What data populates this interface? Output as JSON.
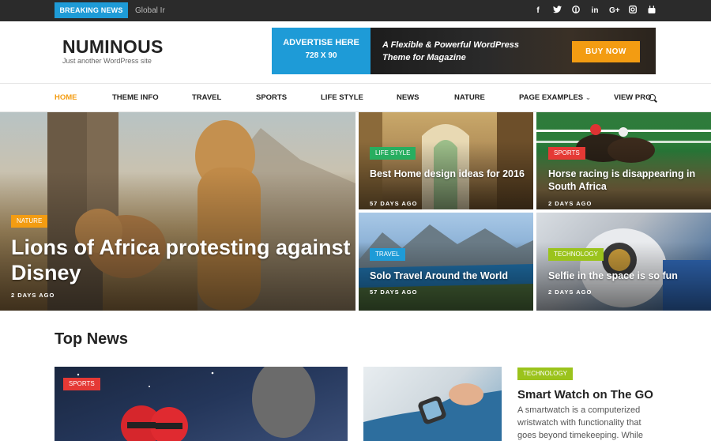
{
  "topbar": {
    "breaking_label": "BREAKING NEWS",
    "ticker": "Global Ir",
    "social": [
      "f",
      "t",
      "p",
      "in",
      "G+",
      "ig",
      "yt"
    ]
  },
  "header": {
    "logo": "NUMINOUS",
    "tagline": "Just another WordPress site",
    "ad": {
      "line1": "ADVERTISE HERE",
      "line2": "728 X 90",
      "promo1": "A Flexible & Powerful WordPress",
      "promo2": "Theme for Magazine",
      "buy": "BUY NOW"
    }
  },
  "nav": {
    "items": [
      "HOME",
      "THEME INFO",
      "TRAVEL",
      "SPORTS",
      "LIFE STYLE",
      "NEWS",
      "NATURE",
      "PAGE EXAMPLES",
      "VIEW PRO"
    ]
  },
  "featured": [
    {
      "category": "NATURE",
      "title": "Lions of Africa protesting against Disney",
      "date": "2 DAYS AGO",
      "color": "#f39c12"
    },
    {
      "category": "LIFE STYLE",
      "title": "Best Home design ideas for 2016",
      "date": "57 DAYS AGO",
      "color": "#27ae60"
    },
    {
      "category": "SPORTS",
      "title": "Horse racing is disappearing in South Africa",
      "date": "2 DAYS AGO",
      "color": "#e53935"
    },
    {
      "category": "TRAVEL",
      "title": "Solo Travel Around the World",
      "date": "57 DAYS AGO",
      "color": "#1e9bd7"
    },
    {
      "category": "TECHNOLOGY",
      "title": "Selfie in the space is so fun",
      "date": "2 DAYS AGO",
      "color": "#9bc31c"
    }
  ],
  "top_news": {
    "heading": "Top News",
    "card1_category": "SPORTS",
    "card2": {
      "category": "TECHNOLOGY",
      "title": "Smart Watch on The GO",
      "desc": "A smartwatch is a computerized wristwatch with functionality that goes beyond timekeeping. While"
    }
  }
}
